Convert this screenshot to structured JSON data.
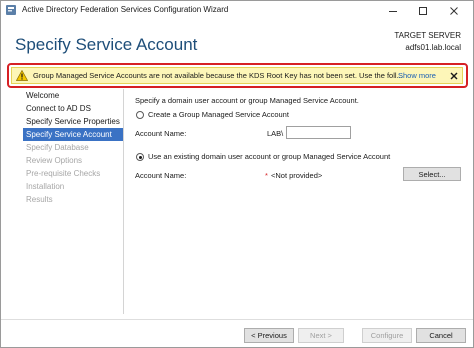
{
  "window": {
    "title": "Active Directory Federation Services Configuration Wizard"
  },
  "header": {
    "title": "Specify Service Account",
    "target_label": "TARGET SERVER",
    "target_host": "adfs01.lab.local"
  },
  "warning": {
    "text": "Group Managed Service Accounts are not available because the KDS Root Key has not been set. Use the foll...",
    "link": "Show more",
    "icon": "warning-icon"
  },
  "nav": {
    "items": [
      {
        "label": "Welcome",
        "state": "normal"
      },
      {
        "label": "Connect to AD DS",
        "state": "normal"
      },
      {
        "label": "Specify Service Properties",
        "state": "normal"
      },
      {
        "label": "Specify Service Account",
        "state": "selected"
      },
      {
        "label": "Specify Database",
        "state": "disabled"
      },
      {
        "label": "Review Options",
        "state": "disabled"
      },
      {
        "label": "Pre-requisite Checks",
        "state": "disabled"
      },
      {
        "label": "Installation",
        "state": "disabled"
      },
      {
        "label": "Results",
        "state": "disabled"
      }
    ]
  },
  "content": {
    "intro": "Specify a domain user account or group Managed Service Account.",
    "option_gmsa": {
      "label": "Create a Group Managed Service Account",
      "checked": false,
      "account_label": "Account Name:",
      "domain_prefix": "LAB\\",
      "account_value": ""
    },
    "option_existing": {
      "label": "Use an existing domain user account or group Managed Service Account",
      "checked": true,
      "account_label": "Account Name:",
      "required_marker": "*",
      "account_value": "<Not provided>",
      "select_button": "Select..."
    }
  },
  "footer": {
    "previous": "< Previous",
    "next": "Next >",
    "configure": "Configure",
    "cancel": "Cancel"
  },
  "colors": {
    "title_blue": "#1e4e79",
    "selected_nav": "#3a72c4",
    "warning_bg": "#fdf6b8",
    "highlight_red": "#d62024",
    "link_blue": "#1a5fb4"
  }
}
